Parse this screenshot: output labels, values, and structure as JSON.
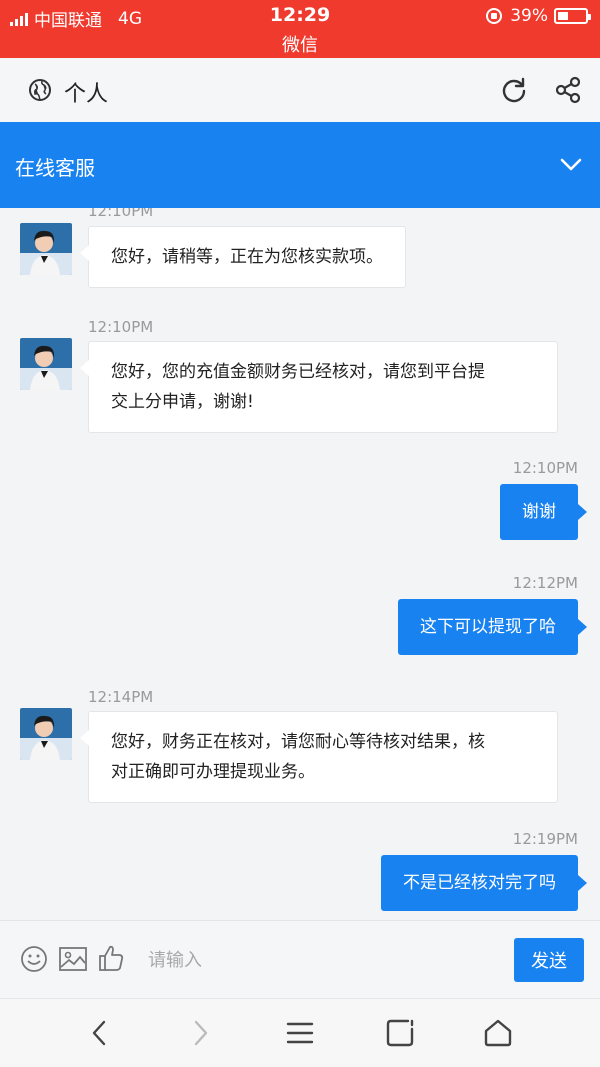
{
  "status_bar": {
    "carrier": "中国联通",
    "network": "4G",
    "time": "12:29",
    "app_name": "微信",
    "battery": "39%",
    "battery_level": 0.39,
    "color": "#f03a2e"
  },
  "header": {
    "title": "个人",
    "icons": [
      "globe-icon",
      "refresh-icon",
      "share-icon"
    ]
  },
  "service_bar": {
    "title": "在线客服",
    "color": "#1882f0",
    "icon": "chevron-down-icon"
  },
  "messages": [
    {
      "direction": "in",
      "time": "12:10PM",
      "text": "您好，请稍等，正在为您核实款项。"
    },
    {
      "direction": "in",
      "time": "12:10PM",
      "lines": [
        "您好，您的充值金额财务已经核对，请您到平台提",
        "交上分申请，谢谢!"
      ]
    },
    {
      "direction": "out",
      "time": "12:10PM",
      "text": "谢谢"
    },
    {
      "direction": "out",
      "time": "12:12PM",
      "text": "这下可以提现了哈"
    },
    {
      "direction": "in",
      "time": "12:14PM",
      "lines": [
        "您好，财务正在核对，请您耐心等待核对结果，核",
        "对正确即可办理提现业务。"
      ]
    },
    {
      "direction": "out",
      "time": "12:19PM",
      "text": "不是已经核对完了吗"
    }
  ],
  "input_bar": {
    "placeholder": "请输入",
    "send_label": "发送",
    "icons": [
      "smile-icon",
      "image-icon",
      "thumb-up-icon"
    ]
  },
  "bottom_nav": {
    "icons": [
      "back-icon",
      "forward-icon",
      "menu-icon",
      "tabs-icon",
      "home-icon"
    ]
  }
}
